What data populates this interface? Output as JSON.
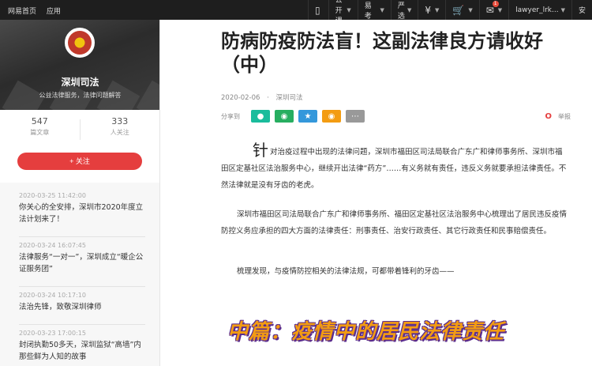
{
  "topbar": {
    "left": [
      "网易首页",
      "应用"
    ],
    "items": [
      "公开课",
      "网易考拉",
      "严选",
      "",
      "",
      "",
      "lawyer_lrk...",
      "安"
    ]
  },
  "sidebar": {
    "name": "深圳司法",
    "subtitle": "公益法律服务，法律问题解答",
    "stats": [
      {
        "value": "547",
        "label": "篇文章"
      },
      {
        "value": "333",
        "label": "人关注"
      }
    ],
    "follow_label": "+ 关注",
    "items": [
      {
        "time": "2020-03-25 11:42:00",
        "title": "你关心的全安排，深圳市2020年度立法计划来了！"
      },
      {
        "time": "2020-03-24 16:07:45",
        "title": "法律服务“一对一”，深圳成立“暖企公证服务团”"
      },
      {
        "time": "2020-03-24 10:17:10",
        "title": "法治先锋，致敬深圳律师"
      },
      {
        "time": "2020-03-23 17:00:15",
        "title": "封闭执勤50多天，深圳监狱“高墙”内那些鲜为人知的故事"
      }
    ]
  },
  "article": {
    "title": "防病防疫防法盲！这副法律良方请收好（中）",
    "date": "2020-02-06",
    "source": "深圳司法",
    "share_label": "分享到",
    "report_label": "举报",
    "dropcap": "针",
    "p1": "对治疫过程中出现的法律问题，深圳市福田区司法局联合广东广和律师事务所、深圳市福田区定基社区法治服务中心，继续开出法律“药方”……有义务就有责任，违反义务就要承担法律责任。不然法律就是没有牙齿的老虎。",
    "p2": "深圳市福田区司法局联合广东广和律师事务所、福田区定基社区法治服务中心梳理出了居民违反疫情防控义务应承担的四大方面的法律责任：刑事责任、治安行政责任、其它行政责任和民事赔偿责任。",
    "p3": "梳理发现，与疫情防控相关的法律法规，可都带着锋利的牙齿——",
    "banner": "中篇：疫情中的居民法律责任"
  },
  "colors": {
    "topbar": "#1e1e1e",
    "follow_button": "#e53e3e",
    "share": [
      "#1abc9c",
      "#27ae60",
      "#3498db",
      "#f39c12",
      "#999999"
    ]
  },
  "icons": [
    "phone-icon",
    "yen-icon",
    "cart-icon",
    "mail-icon",
    "chevron-down-icon"
  ]
}
